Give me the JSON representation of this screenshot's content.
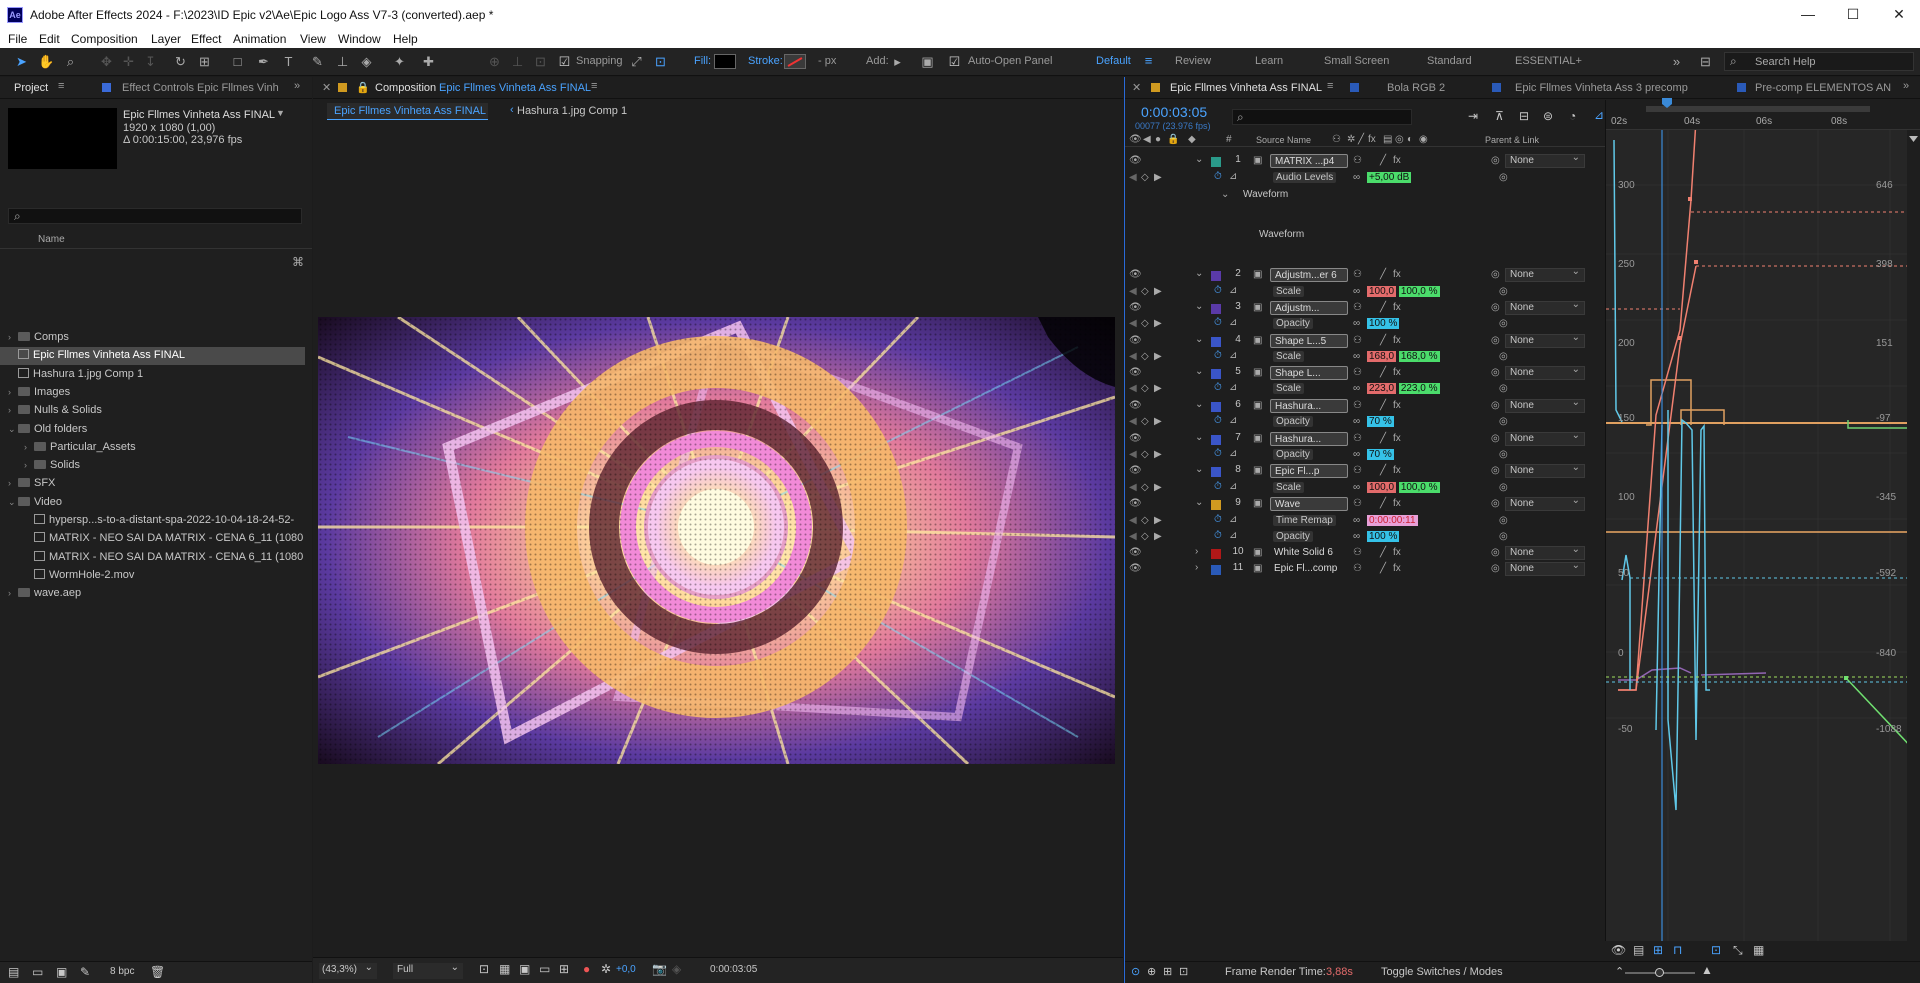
{
  "app": {
    "title": "Adobe After Effects 2024 - F:\\2023\\ID Epic v2\\Ae\\Epic Logo Ass V7-3 (converted).aep *",
    "logo": "Ae"
  },
  "window_controls": {
    "minimize": "—",
    "maximize": "☐",
    "close": "✕"
  },
  "menu": [
    "File",
    "Edit",
    "Composition",
    "Layer",
    "Effect",
    "Animation",
    "View",
    "Window",
    "Help"
  ],
  "toolbar": {
    "snapping": "Snapping",
    "fill": "Fill:",
    "stroke": "Stroke:",
    "px": "- px",
    "add": "Add:",
    "auto_open": "Auto-Open Panel",
    "workspaces": [
      "Default",
      "Review",
      "Learn",
      "Small Screen",
      "Standard",
      "ESSENTIAL+"
    ],
    "search_help": "Search Help"
  },
  "project_panel": {
    "tab_project": "Project",
    "tab_effect": "Effect Controls Epic Fllmes Vinh",
    "comp_name": "Epic Fllmes Vinheta Ass FINAL",
    "comp_size": "1920 x 1080 (1,00)",
    "comp_duration": "Δ 0:00:15:00, 23,976 fps",
    "name_header": "Name",
    "bpc": "8 bpc",
    "items": [
      {
        "label": "Comps",
        "type": "folder",
        "indent": 0
      },
      {
        "label": "Epic Fllmes Vinheta Ass FINAL",
        "type": "comp",
        "indent": 0,
        "selected": true
      },
      {
        "label": "Hashura 1.jpg Comp 1",
        "type": "comp",
        "indent": 0
      },
      {
        "label": "Images",
        "type": "folder",
        "indent": 0
      },
      {
        "label": "Nulls & Solids",
        "type": "folder",
        "indent": 0
      },
      {
        "label": "Old folders",
        "type": "folder",
        "indent": 0,
        "open": true
      },
      {
        "label": "Particular_Assets",
        "type": "folder",
        "indent": 1
      },
      {
        "label": "Solids",
        "type": "folder",
        "indent": 1
      },
      {
        "label": "SFX",
        "type": "folder",
        "indent": 0
      },
      {
        "label": "Video",
        "type": "folder",
        "indent": 0,
        "open": true
      },
      {
        "label": "hypersp...s-to-a-distant-spa-2022-10-04-18-24-52-",
        "type": "file",
        "indent": 1
      },
      {
        "label": "MATRIX - NEO SAI DA MATRIX - CENA 6_11 (1080",
        "type": "file",
        "indent": 1
      },
      {
        "label": "MATRIX - NEO SAI DA MATRIX - CENA 6_11 (1080",
        "type": "file",
        "indent": 1
      },
      {
        "label": "WormHole-2.mov",
        "type": "file",
        "indent": 1
      },
      {
        "label": "wave.aep",
        "type": "folder",
        "indent": 0
      }
    ]
  },
  "comp_panel": {
    "tab_label": "Composition",
    "tab_name": "Epic Fllmes Vinheta Ass FINAL",
    "breadcrumb_1": "Epic Fllmes Vinheta Ass FINAL",
    "breadcrumb_2": "Hashura 1.jpg Comp 1",
    "zoom": "(43,3%)",
    "resolution": "Full",
    "exposure": "+0,0",
    "timecode": "0:00:03:05"
  },
  "timeline": {
    "tabs": [
      "Epic Fllmes Vinheta Ass FINAL",
      "Bola RGB 2",
      "Epic Fllmes Vinheta Ass 3 precomp",
      "Pre-comp ELEMENTOS AN"
    ],
    "timecode": "0:00:03:05",
    "frame_info": "00077 (23.976 fps)",
    "col_source": "Source Name",
    "col_parent": "Parent & Link",
    "ruler": [
      "02s",
      "04s",
      "06s",
      "08s"
    ],
    "graph_left": [
      "300",
      "250",
      "200",
      "150",
      "100",
      "50",
      "0",
      "-50"
    ],
    "graph_right": [
      "646",
      "398",
      "151",
      "-97",
      "-345",
      "-592",
      "-840",
      "-1088"
    ],
    "frame_render_label": "Frame Render Time:",
    "frame_render_value": "3,88s",
    "toggle": "Toggle Switches / Modes",
    "waveform_label": "Waveform",
    "waveform_text": "Waveform",
    "layers": [
      {
        "num": "1",
        "name": "MATRIX ...p4",
        "color": "#2a9a8a",
        "parent": "None",
        "prop": "Audio Levels",
        "val1": "+5,00 dB",
        "val_style": "g"
      },
      {
        "num": "2",
        "name": "Adjustm...er 6",
        "color": "#5a3aa8",
        "parent": "None",
        "prop": "Scale",
        "val1": "100,0",
        "val2": "100,0 %",
        "val_style": "rg"
      },
      {
        "num": "3",
        "name": "Adjustm...",
        "color": "#5a3aa8",
        "parent": "None",
        "prop": "Opacity",
        "val1": "100 %",
        "val_style": "b"
      },
      {
        "num": "4",
        "name": "Shape L...5",
        "color": "#3a55c8",
        "parent": "None",
        "prop": "Scale",
        "val1": "168,0",
        "val2": "168,0 %",
        "val_style": "rg"
      },
      {
        "num": "5",
        "name": "Shape L...",
        "color": "#3a55c8",
        "parent": "None",
        "prop": "Scale",
        "val1": "223,0",
        "val2": "223,0 %",
        "val_style": "rg"
      },
      {
        "num": "6",
        "name": "Hashura...",
        "color": "#3a55c8",
        "parent": "None",
        "prop": "Opacity",
        "val1": "70 %",
        "val_style": "b"
      },
      {
        "num": "7",
        "name": "Hashura...",
        "color": "#3a55c8",
        "parent": "None",
        "prop": "Opacity",
        "val1": "70 %",
        "val_style": "b"
      },
      {
        "num": "8",
        "name": "Epic Fl...p",
        "color": "#3a55c8",
        "parent": "None",
        "prop": "Scale",
        "val1": "100,0",
        "val2": "100,0 %",
        "val_style": "rg"
      },
      {
        "num": "9",
        "name": "Wave",
        "color": "#d09a20",
        "parent": "None",
        "prop": "Time Remap",
        "val1": "0:00:00:11",
        "prop2": "Opacity",
        "val2b": "100 %"
      },
      {
        "num": "10",
        "name": "White Solid 6",
        "color": "#b01818",
        "parent": "None"
      },
      {
        "num": "11",
        "name": "Epic Fl...comp",
        "color": "#2a5ab8",
        "parent": "None"
      }
    ]
  }
}
